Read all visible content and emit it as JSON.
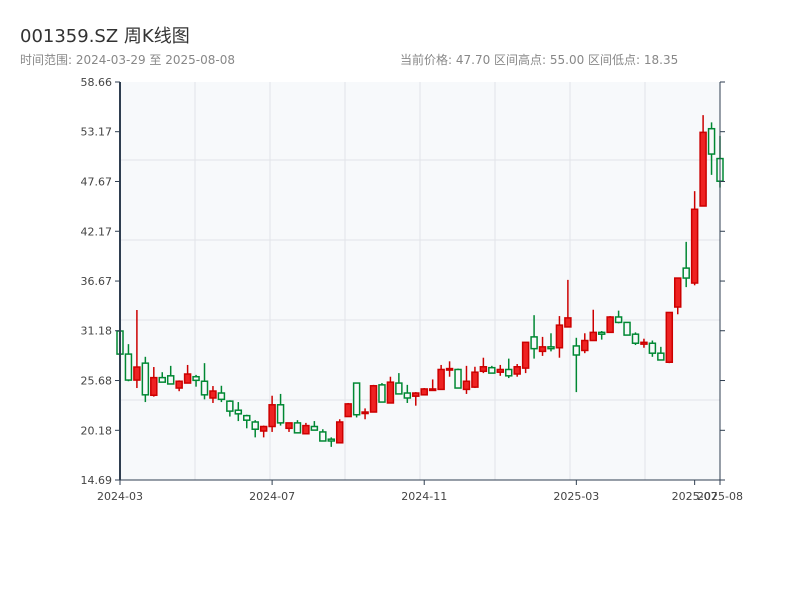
{
  "header": {
    "title": "001359.SZ 周K线图",
    "range_text": "时间范围: 2024-03-29 至 2025-08-08",
    "stats_text": "当前价格: 47.70  区间高点: 55.00  区间低点: 18.35"
  },
  "chart_data": {
    "type": "candlestick",
    "title": "001359.SZ 周K线图",
    "x_range": [
      "2024-03-29",
      "2025-08-08"
    ],
    "interval": "weekly",
    "ylim": [
      14.69,
      58.66
    ],
    "y_ticks": [
      "58.66",
      "53.17",
      "47.67",
      "42.17",
      "36.67",
      "31.18",
      "25.68",
      "20.18",
      "14.69"
    ],
    "x_ticks": [
      {
        "index": 0,
        "label": "2024-03"
      },
      {
        "index": 18,
        "label": "2024-07"
      },
      {
        "index": 36,
        "label": "2024-11"
      },
      {
        "index": 54,
        "label": "2025-03"
      },
      {
        "index": 68,
        "label": "2025-07"
      },
      {
        "index": 71,
        "label": "2025-08"
      }
    ],
    "grid": true,
    "colors": {
      "up": "#ee2222",
      "up_stroke": "#cc0000",
      "down": "#008833"
    },
    "candle_fields": [
      "open",
      "close",
      "high",
      "low"
    ],
    "candles": [
      [
        31.15,
        28.6,
        31.3,
        28.5
      ],
      [
        28.6,
        25.73,
        29.7,
        25.6
      ],
      [
        25.73,
        27.17,
        33.47,
        24.85
      ],
      [
        27.6,
        24.1,
        28.3,
        23.3
      ],
      [
        24.05,
        26.0,
        27.17,
        23.9
      ],
      [
        26.0,
        25.5,
        26.6,
        25.5
      ],
      [
        26.2,
        25.3,
        27.3,
        25.3
      ],
      [
        24.85,
        25.6,
        25.7,
        24.5
      ],
      [
        25.4,
        26.4,
        27.4,
        25.4
      ],
      [
        26.1,
        25.7,
        26.3,
        25.0
      ],
      [
        25.6,
        24.1,
        27.6,
        23.6
      ],
      [
        23.75,
        24.52,
        25.07,
        23.2
      ],
      [
        24.3,
        23.6,
        25.1,
        23.3
      ],
      [
        23.4,
        22.3,
        23.5,
        21.7
      ],
      [
        22.4,
        22.0,
        23.3,
        21.2
      ],
      [
        21.8,
        21.3,
        21.9,
        20.4
      ],
      [
        21.1,
        20.3,
        21.3,
        19.4
      ],
      [
        20.1,
        20.6,
        20.7,
        19.4
      ],
      [
        20.6,
        23.0,
        24.0,
        20.0
      ],
      [
        23.0,
        21.0,
        24.2,
        20.7
      ],
      [
        20.4,
        21.0,
        21.0,
        20.0
      ],
      [
        21.0,
        19.9,
        21.3,
        19.9
      ],
      [
        19.8,
        20.7,
        21.0,
        19.8
      ],
      [
        20.6,
        20.2,
        21.2,
        20.2
      ],
      [
        20.0,
        19.0,
        20.3,
        19.0
      ],
      [
        19.2,
        19.0,
        19.4,
        18.35
      ],
      [
        18.8,
        21.1,
        21.4,
        18.8
      ],
      [
        21.7,
        23.1,
        23.2,
        21.7
      ],
      [
        25.4,
        21.9,
        25.4,
        21.6
      ],
      [
        22.1,
        22.2,
        22.6,
        21.4
      ],
      [
        22.2,
        25.1,
        25.2,
        22.2
      ],
      [
        25.2,
        23.3,
        25.4,
        23.3
      ],
      [
        23.2,
        25.5,
        26.1,
        23.2
      ],
      [
        25.4,
        24.2,
        26.5,
        24.2
      ],
      [
        24.3,
        23.75,
        25.2,
        23.2
      ],
      [
        23.95,
        24.3,
        24.4,
        22.9
      ],
      [
        24.1,
        24.75,
        24.85,
        24.1
      ],
      [
        24.6,
        24.75,
        25.8,
        24.6
      ],
      [
        24.7,
        26.9,
        27.4,
        24.7
      ],
      [
        26.85,
        27.0,
        27.8,
        26.1
      ],
      [
        26.9,
        24.85,
        27.0,
        24.85
      ],
      [
        24.7,
        25.6,
        27.3,
        24.2
      ],
      [
        24.95,
        26.6,
        27.2,
        24.85
      ],
      [
        26.7,
        27.2,
        28.2,
        26.5
      ],
      [
        27.1,
        26.5,
        27.3,
        26.5
      ],
      [
        26.6,
        26.9,
        27.4,
        26.2
      ],
      [
        26.9,
        26.2,
        28.1,
        25.95
      ],
      [
        26.4,
        27.2,
        27.5,
        26.1
      ],
      [
        27.05,
        29.9,
        29.9,
        26.5
      ],
      [
        30.5,
        29.2,
        32.9,
        28.1
      ],
      [
        28.9,
        29.4,
        30.5,
        28.4
      ],
      [
        29.4,
        29.2,
        30.9,
        28.9
      ],
      [
        29.3,
        31.8,
        32.8,
        28.2
      ],
      [
        31.6,
        32.6,
        36.8,
        31.6
      ],
      [
        29.5,
        28.5,
        30.4,
        24.4
      ],
      [
        29.0,
        30.1,
        30.9,
        28.7
      ],
      [
        30.1,
        31.0,
        33.5,
        30.1
      ],
      [
        31.0,
        30.8,
        31.15,
        30.2
      ],
      [
        31.0,
        32.7,
        32.8,
        31.0
      ],
      [
        32.7,
        32.1,
        33.4,
        32.0
      ],
      [
        32.1,
        30.7,
        32.1,
        30.7
      ],
      [
        30.8,
        29.8,
        31.0,
        29.6
      ],
      [
        29.7,
        29.9,
        30.3,
        29.3
      ],
      [
        29.8,
        28.7,
        30.1,
        28.3
      ],
      [
        28.7,
        27.95,
        29.4,
        27.95
      ],
      [
        27.7,
        33.2,
        33.2,
        27.6
      ],
      [
        33.8,
        37.0,
        37.0,
        33.0
      ],
      [
        38.1,
        37.0,
        41.0,
        36.0
      ],
      [
        36.45,
        44.6,
        46.6,
        36.2
      ],
      [
        44.96,
        53.1,
        55.0,
        44.96
      ],
      [
        53.5,
        50.7,
        54.2,
        48.4
      ],
      [
        50.2,
        47.7,
        52.7,
        47.0
      ]
    ]
  }
}
